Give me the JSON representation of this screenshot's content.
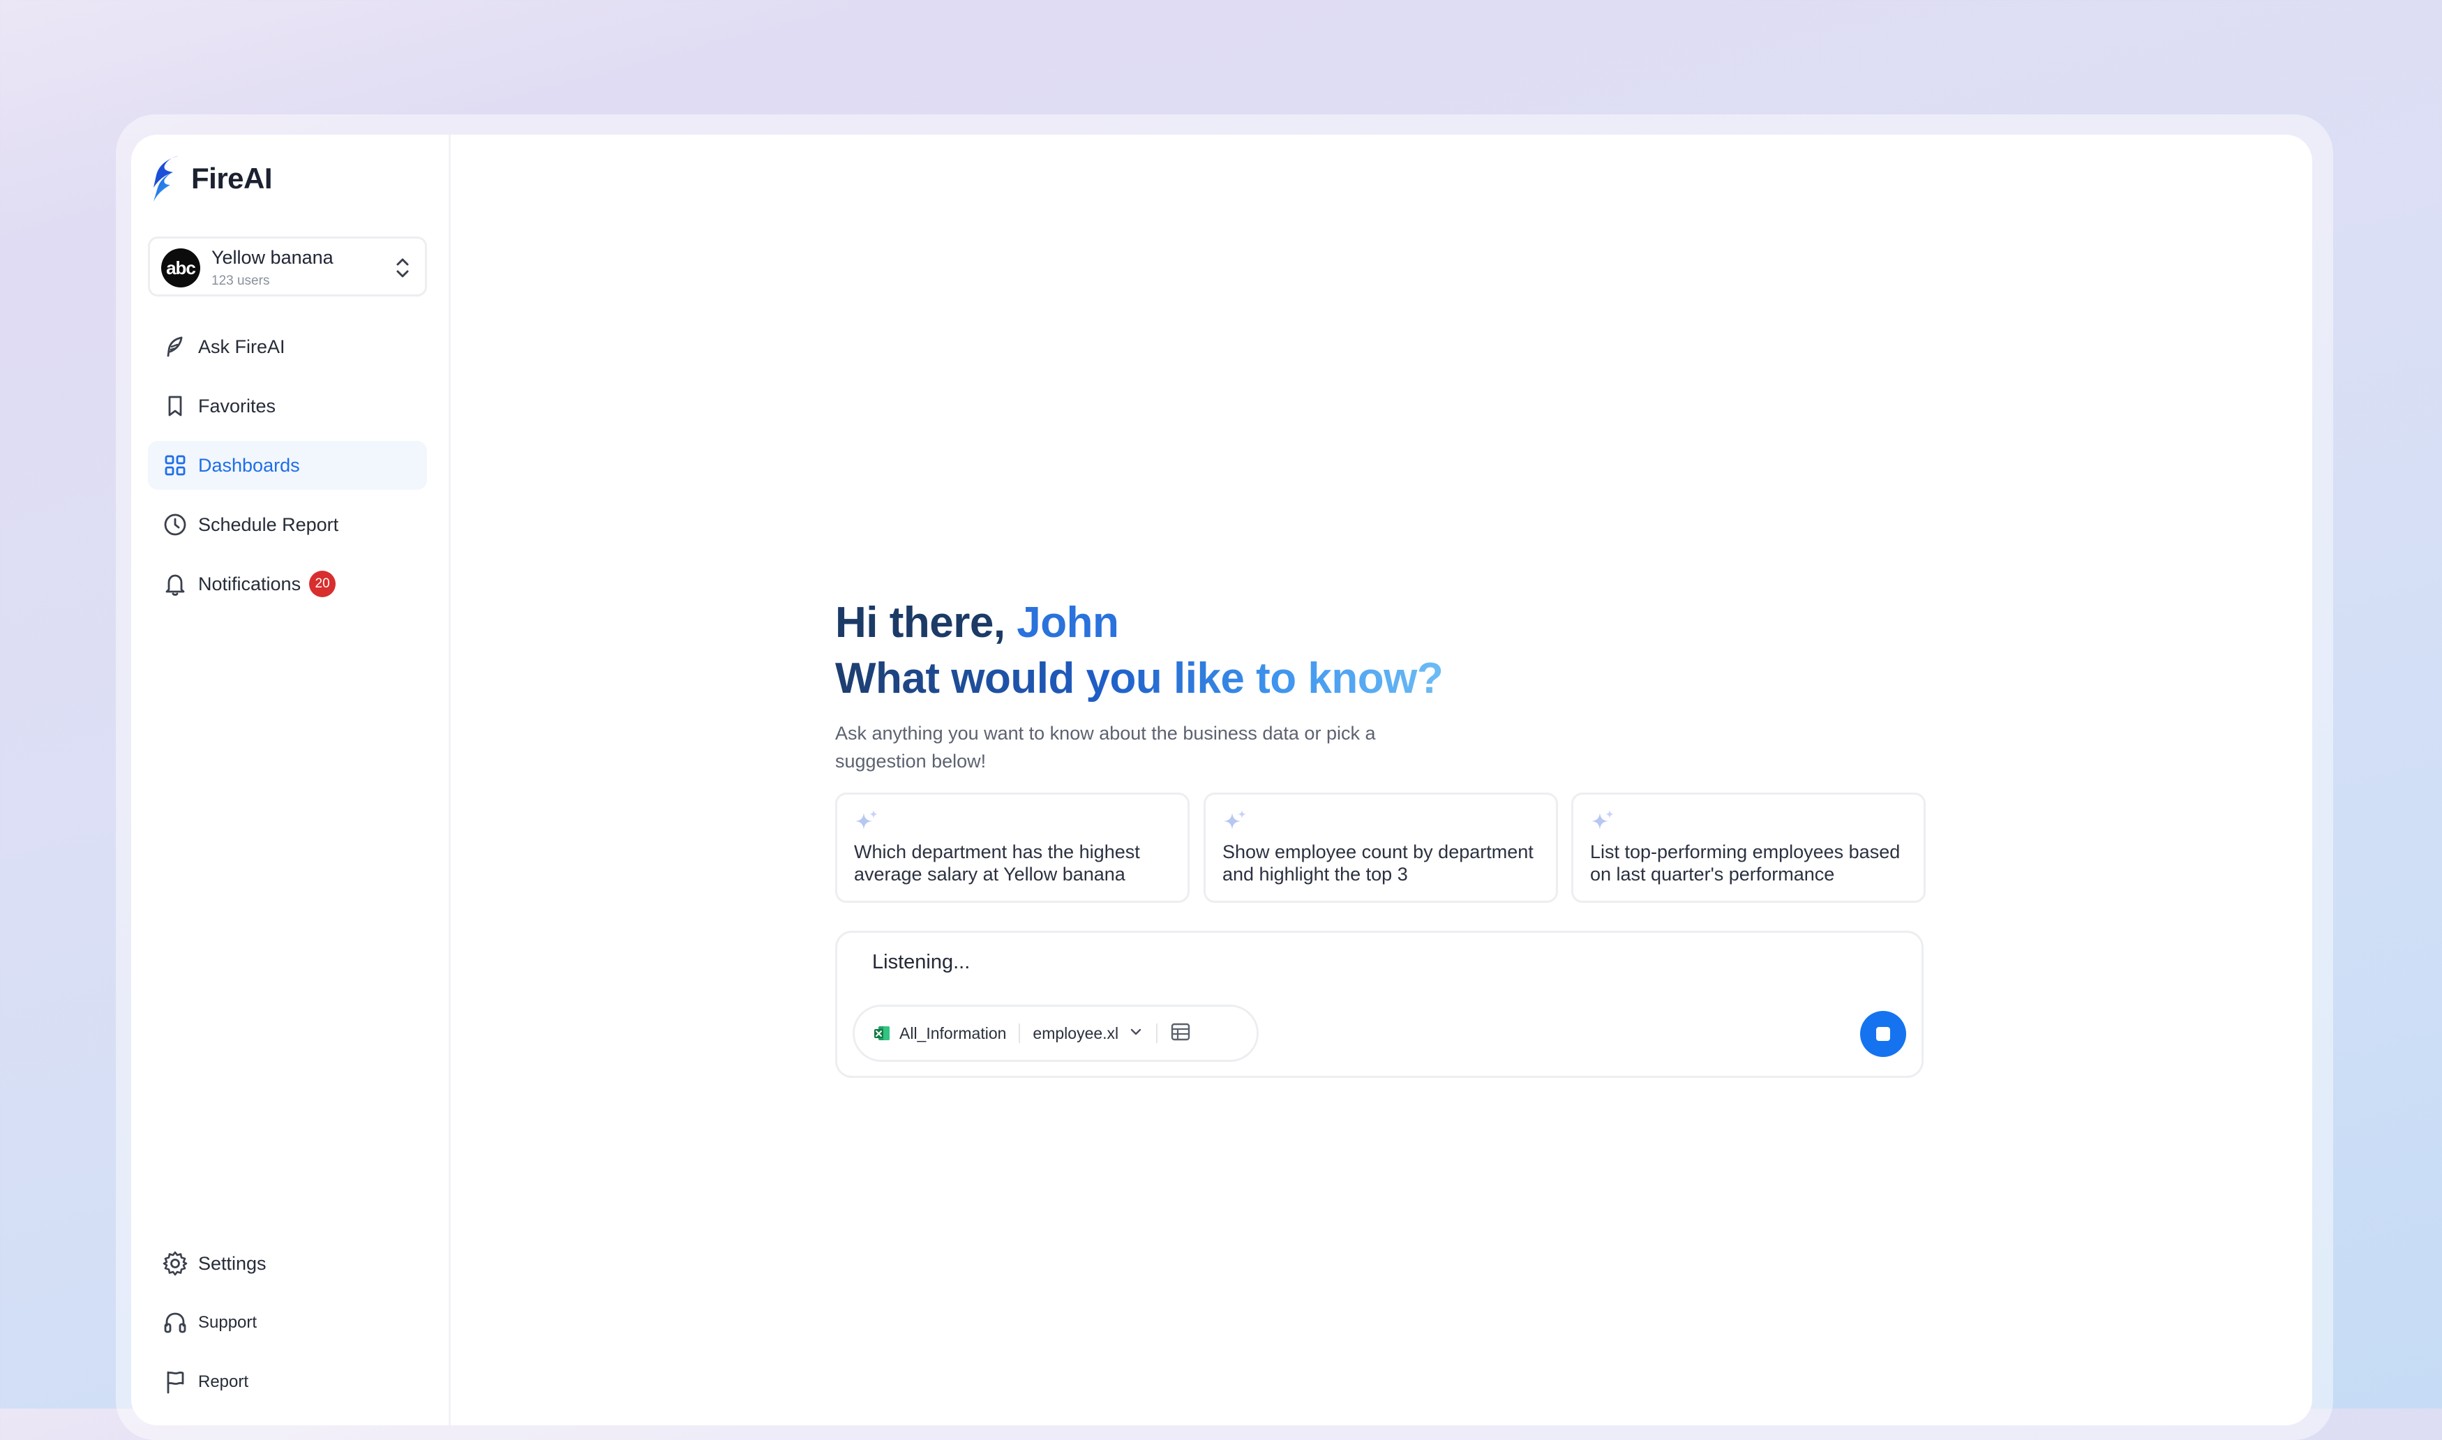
{
  "brand": {
    "name": "FireAI"
  },
  "workspace": {
    "avatar_text": "abc",
    "name": "Yellow banana",
    "sub": "123 users"
  },
  "nav": {
    "items": [
      {
        "label": "Ask FireAI",
        "icon": "feather-icon",
        "active": false
      },
      {
        "label": "Favorites",
        "icon": "bookmark-icon",
        "active": false
      },
      {
        "label": "Dashboards",
        "icon": "grid-icon",
        "active": true
      },
      {
        "label": "Schedule Report",
        "icon": "clock-icon",
        "active": false
      },
      {
        "label": "Notifications",
        "icon": "bell-icon",
        "active": false,
        "badge": "20"
      }
    ],
    "bottom": [
      {
        "label": "Settings",
        "icon": "gear-icon"
      },
      {
        "label": "Support",
        "icon": "headset-icon"
      },
      {
        "label": "Report",
        "icon": "flag-icon"
      }
    ]
  },
  "greeting": {
    "line1_prefix": "Hi there, ",
    "user_name": "John",
    "line2": "What would you like to know?"
  },
  "subtitle": "Ask anything you want to know about the business data or pick a suggestion below!",
  "suggestions": [
    {
      "text": "Which department has the highest average salary at Yellow banana"
    },
    {
      "text": "Show employee count by department and highlight the top 3"
    },
    {
      "text": "List top-performing employees based on last quarter's performance"
    }
  ],
  "chat": {
    "input_value": "Listening...",
    "source_label": "All_Information",
    "file_name": "employee.xl"
  },
  "colors": {
    "accent": "#1573f0",
    "badge": "#d82e2e",
    "heading_dark": "#1c3a66"
  }
}
